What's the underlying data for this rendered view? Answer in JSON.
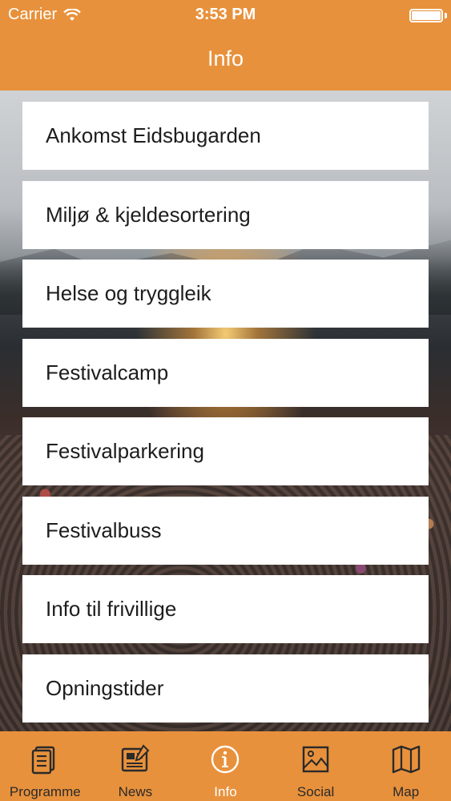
{
  "status_bar": {
    "carrier": "Carrier",
    "time": "3:53 PM"
  },
  "nav": {
    "title": "Info"
  },
  "menu": {
    "items": [
      {
        "label": "Ankomst Eidsbugarden"
      },
      {
        "label": "Miljø & kjeldesortering"
      },
      {
        "label": "Helse og tryggleik"
      },
      {
        "label": "Festivalcamp"
      },
      {
        "label": "Festivalparkering"
      },
      {
        "label": "Festivalbuss"
      },
      {
        "label": "Info til frivillige"
      },
      {
        "label": "Opningstider"
      }
    ]
  },
  "tabbar": {
    "active_tab": "Info",
    "tabs": [
      {
        "label": "Programme",
        "icon": "document-icon"
      },
      {
        "label": "News",
        "icon": "newspaper-icon"
      },
      {
        "label": "Info",
        "icon": "info-icon"
      },
      {
        "label": "Social",
        "icon": "picture-icon"
      },
      {
        "label": "Map",
        "icon": "map-icon"
      }
    ]
  },
  "colors": {
    "accent": "#e8913c",
    "tab_inactive": "#2a2a2a",
    "tab_active": "#ffffff",
    "card_bg": "#ffffff"
  }
}
